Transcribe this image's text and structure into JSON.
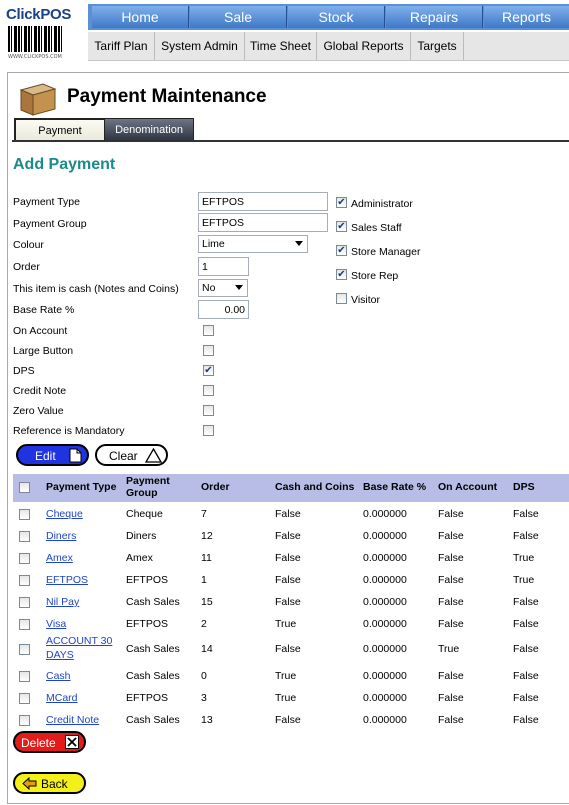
{
  "logo": {
    "name": "ClickPOS",
    "tagline": "WWW.CLICKPOS.COM"
  },
  "topnav": [
    "Home",
    "Sale",
    "Stock",
    "Repairs",
    "Reports"
  ],
  "subnav": [
    "Tariff Plan",
    "System Admin",
    "Time Sheet",
    "Global Reports",
    "Targets"
  ],
  "page": {
    "title": "Payment Maintenance"
  },
  "tabs": [
    "Payment",
    "Denomination"
  ],
  "form": {
    "heading": "Add Payment",
    "labels": {
      "payment_type": "Payment Type",
      "payment_group": "Payment Group",
      "colour": "Colour",
      "order": "Order",
      "is_cash": "This item is cash (Notes and Coins)",
      "base_rate": "Base Rate %",
      "on_account": "On Account",
      "large_button": "Large Button",
      "dps": "DPS",
      "credit_note": "Credit Note",
      "zero_value": "Zero Value",
      "reference_mandatory": "Reference is Mandatory"
    },
    "values": {
      "payment_type": "EFTPOS",
      "payment_group": "EFTPOS",
      "colour": "Lime",
      "order": "1",
      "is_cash": "No",
      "base_rate": "0.00",
      "on_account": false,
      "large_button": false,
      "dps": true,
      "credit_note": false,
      "zero_value": false,
      "reference_mandatory": false
    },
    "roles": [
      {
        "label": "Administrator",
        "checked": true
      },
      {
        "label": "Sales Staff",
        "checked": true
      },
      {
        "label": "Store Manager",
        "checked": true
      },
      {
        "label": "Store Rep",
        "checked": true
      },
      {
        "label": "Visitor",
        "checked": false
      }
    ]
  },
  "buttons": {
    "edit": "Edit",
    "clear": "Clear",
    "delete": "Delete",
    "back": "Back"
  },
  "table": {
    "headers": [
      "Payment Type",
      "Payment Group",
      "Order",
      "Cash and Coins",
      "Base Rate %",
      "On Account",
      "DPS"
    ],
    "rows": [
      [
        "Cheque",
        "Cheque",
        "7",
        "False",
        "0.000000",
        "False",
        "False"
      ],
      [
        "Diners",
        "Diners",
        "12",
        "False",
        "0.000000",
        "False",
        "False"
      ],
      [
        "Amex",
        "Amex",
        "11",
        "False",
        "0.000000",
        "False",
        "True"
      ],
      [
        "EFTPOS",
        "EFTPOS",
        "1",
        "False",
        "0.000000",
        "False",
        "True"
      ],
      [
        "Nil Pay",
        "Cash Sales",
        "15",
        "False",
        "0.000000",
        "False",
        "False"
      ],
      [
        "Visa",
        "EFTPOS",
        "2",
        "True",
        "0.000000",
        "False",
        "False"
      ],
      [
        "ACCOUNT 30 DAYS",
        "Cash Sales",
        "14",
        "False",
        "0.000000",
        "True",
        "False"
      ],
      [
        "Cash",
        "Cash Sales",
        "0",
        "True",
        "0.000000",
        "False",
        "False"
      ],
      [
        "MCard",
        "EFTPOS",
        "3",
        "True",
        "0.000000",
        "False",
        "False"
      ],
      [
        "Credit Note",
        "Cash Sales",
        "13",
        "False",
        "0.000000",
        "False",
        "False"
      ]
    ]
  }
}
